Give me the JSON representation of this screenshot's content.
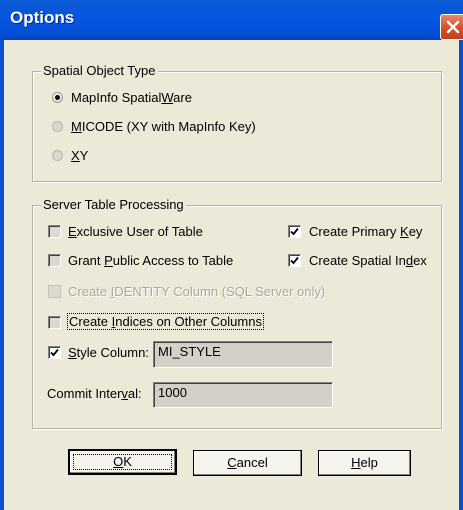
{
  "window": {
    "title": "Options",
    "close_icon": "close-icon"
  },
  "spatial_group": {
    "legend": "Spatial Object Type",
    "options": [
      {
        "label_pre": "MapInfo Spatial",
        "label_u": "W",
        "label_post": "are",
        "selected": true
      },
      {
        "label_pre": "",
        "label_u": "M",
        "label_post": "ICODE (XY with MapInfo Key)",
        "selected": false
      },
      {
        "label_pre": "",
        "label_u": "X",
        "label_post": "Y",
        "selected": false
      }
    ]
  },
  "server_group": {
    "legend": "Server Table Processing",
    "exclusive": {
      "label_u": "E",
      "label_post": "xclusive User of Table",
      "checked": false
    },
    "grant": {
      "label_pre": "Grant ",
      "label_u": "P",
      "label_post": "ublic Access to Table",
      "checked": false
    },
    "primary_key": {
      "label_pre": "Create Primary ",
      "label_u": "K",
      "label_post": "ey",
      "checked": true
    },
    "spatial_index": {
      "label_pre": "Create Spatial In",
      "label_u": "d",
      "label_post": "ex",
      "checked": true
    },
    "identity": {
      "label_pre": "Create ",
      "label_u": "I",
      "label_post": "DENTITY Column (SQL Server only)",
      "checked": false,
      "disabled": true
    },
    "indices": {
      "label_pre": "Create ",
      "label_u": "I",
      "label_post": "ndices on Other Columns",
      "checked": false
    },
    "style_column": {
      "label_u": "S",
      "label_post": "tyle Column:",
      "checked": true,
      "value": "MI_STYLE"
    },
    "commit_interval": {
      "label_pre": "Commit Inter",
      "label_u": "v",
      "label_post": "al:",
      "value": "1000"
    }
  },
  "buttons": {
    "ok": {
      "label_u": "O",
      "label_post": "K"
    },
    "cancel": {
      "label_u": "C",
      "label_post": "ancel"
    },
    "help": {
      "label_u": "H",
      "label_post": "elp"
    }
  }
}
